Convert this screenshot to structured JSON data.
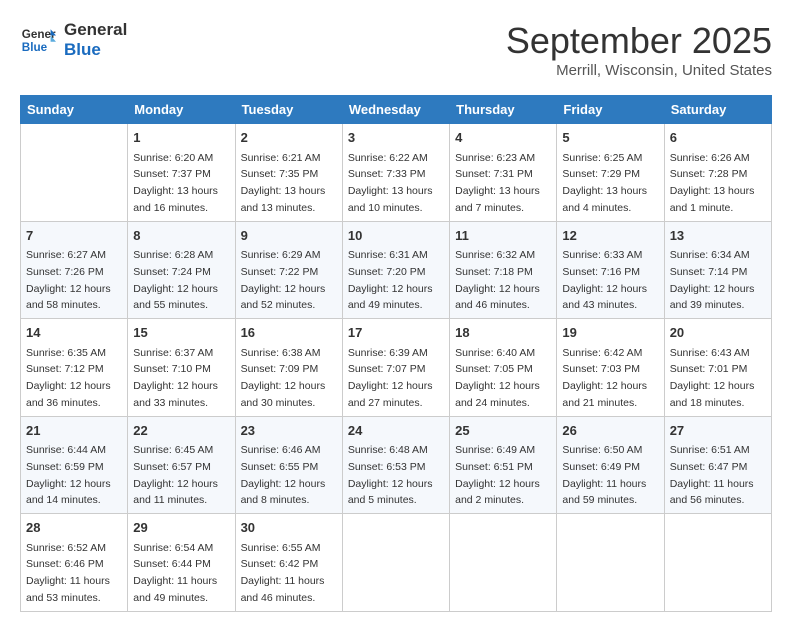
{
  "header": {
    "logo_line1": "General",
    "logo_line2": "Blue",
    "month": "September 2025",
    "location": "Merrill, Wisconsin, United States"
  },
  "weekdays": [
    "Sunday",
    "Monday",
    "Tuesday",
    "Wednesday",
    "Thursday",
    "Friday",
    "Saturday"
  ],
  "weeks": [
    [
      {
        "day": "",
        "sunrise": "",
        "sunset": "",
        "daylight": ""
      },
      {
        "day": "1",
        "sunrise": "Sunrise: 6:20 AM",
        "sunset": "Sunset: 7:37 PM",
        "daylight": "Daylight: 13 hours and 16 minutes."
      },
      {
        "day": "2",
        "sunrise": "Sunrise: 6:21 AM",
        "sunset": "Sunset: 7:35 PM",
        "daylight": "Daylight: 13 hours and 13 minutes."
      },
      {
        "day": "3",
        "sunrise": "Sunrise: 6:22 AM",
        "sunset": "Sunset: 7:33 PM",
        "daylight": "Daylight: 13 hours and 10 minutes."
      },
      {
        "day": "4",
        "sunrise": "Sunrise: 6:23 AM",
        "sunset": "Sunset: 7:31 PM",
        "daylight": "Daylight: 13 hours and 7 minutes."
      },
      {
        "day": "5",
        "sunrise": "Sunrise: 6:25 AM",
        "sunset": "Sunset: 7:29 PM",
        "daylight": "Daylight: 13 hours and 4 minutes."
      },
      {
        "day": "6",
        "sunrise": "Sunrise: 6:26 AM",
        "sunset": "Sunset: 7:28 PM",
        "daylight": "Daylight: 13 hours and 1 minute."
      }
    ],
    [
      {
        "day": "7",
        "sunrise": "Sunrise: 6:27 AM",
        "sunset": "Sunset: 7:26 PM",
        "daylight": "Daylight: 12 hours and 58 minutes."
      },
      {
        "day": "8",
        "sunrise": "Sunrise: 6:28 AM",
        "sunset": "Sunset: 7:24 PM",
        "daylight": "Daylight: 12 hours and 55 minutes."
      },
      {
        "day": "9",
        "sunrise": "Sunrise: 6:29 AM",
        "sunset": "Sunset: 7:22 PM",
        "daylight": "Daylight: 12 hours and 52 minutes."
      },
      {
        "day": "10",
        "sunrise": "Sunrise: 6:31 AM",
        "sunset": "Sunset: 7:20 PM",
        "daylight": "Daylight: 12 hours and 49 minutes."
      },
      {
        "day": "11",
        "sunrise": "Sunrise: 6:32 AM",
        "sunset": "Sunset: 7:18 PM",
        "daylight": "Daylight: 12 hours and 46 minutes."
      },
      {
        "day": "12",
        "sunrise": "Sunrise: 6:33 AM",
        "sunset": "Sunset: 7:16 PM",
        "daylight": "Daylight: 12 hours and 43 minutes."
      },
      {
        "day": "13",
        "sunrise": "Sunrise: 6:34 AM",
        "sunset": "Sunset: 7:14 PM",
        "daylight": "Daylight: 12 hours and 39 minutes."
      }
    ],
    [
      {
        "day": "14",
        "sunrise": "Sunrise: 6:35 AM",
        "sunset": "Sunset: 7:12 PM",
        "daylight": "Daylight: 12 hours and 36 minutes."
      },
      {
        "day": "15",
        "sunrise": "Sunrise: 6:37 AM",
        "sunset": "Sunset: 7:10 PM",
        "daylight": "Daylight: 12 hours and 33 minutes."
      },
      {
        "day": "16",
        "sunrise": "Sunrise: 6:38 AM",
        "sunset": "Sunset: 7:09 PM",
        "daylight": "Daylight: 12 hours and 30 minutes."
      },
      {
        "day": "17",
        "sunrise": "Sunrise: 6:39 AM",
        "sunset": "Sunset: 7:07 PM",
        "daylight": "Daylight: 12 hours and 27 minutes."
      },
      {
        "day": "18",
        "sunrise": "Sunrise: 6:40 AM",
        "sunset": "Sunset: 7:05 PM",
        "daylight": "Daylight: 12 hours and 24 minutes."
      },
      {
        "day": "19",
        "sunrise": "Sunrise: 6:42 AM",
        "sunset": "Sunset: 7:03 PM",
        "daylight": "Daylight: 12 hours and 21 minutes."
      },
      {
        "day": "20",
        "sunrise": "Sunrise: 6:43 AM",
        "sunset": "Sunset: 7:01 PM",
        "daylight": "Daylight: 12 hours and 18 minutes."
      }
    ],
    [
      {
        "day": "21",
        "sunrise": "Sunrise: 6:44 AM",
        "sunset": "Sunset: 6:59 PM",
        "daylight": "Daylight: 12 hours and 14 minutes."
      },
      {
        "day": "22",
        "sunrise": "Sunrise: 6:45 AM",
        "sunset": "Sunset: 6:57 PM",
        "daylight": "Daylight: 12 hours and 11 minutes."
      },
      {
        "day": "23",
        "sunrise": "Sunrise: 6:46 AM",
        "sunset": "Sunset: 6:55 PM",
        "daylight": "Daylight: 12 hours and 8 minutes."
      },
      {
        "day": "24",
        "sunrise": "Sunrise: 6:48 AM",
        "sunset": "Sunset: 6:53 PM",
        "daylight": "Daylight: 12 hours and 5 minutes."
      },
      {
        "day": "25",
        "sunrise": "Sunrise: 6:49 AM",
        "sunset": "Sunset: 6:51 PM",
        "daylight": "Daylight: 12 hours and 2 minutes."
      },
      {
        "day": "26",
        "sunrise": "Sunrise: 6:50 AM",
        "sunset": "Sunset: 6:49 PM",
        "daylight": "Daylight: 11 hours and 59 minutes."
      },
      {
        "day": "27",
        "sunrise": "Sunrise: 6:51 AM",
        "sunset": "Sunset: 6:47 PM",
        "daylight": "Daylight: 11 hours and 56 minutes."
      }
    ],
    [
      {
        "day": "28",
        "sunrise": "Sunrise: 6:52 AM",
        "sunset": "Sunset: 6:46 PM",
        "daylight": "Daylight: 11 hours and 53 minutes."
      },
      {
        "day": "29",
        "sunrise": "Sunrise: 6:54 AM",
        "sunset": "Sunset: 6:44 PM",
        "daylight": "Daylight: 11 hours and 49 minutes."
      },
      {
        "day": "30",
        "sunrise": "Sunrise: 6:55 AM",
        "sunset": "Sunset: 6:42 PM",
        "daylight": "Daylight: 11 hours and 46 minutes."
      },
      {
        "day": "",
        "sunrise": "",
        "sunset": "",
        "daylight": ""
      },
      {
        "day": "",
        "sunrise": "",
        "sunset": "",
        "daylight": ""
      },
      {
        "day": "",
        "sunrise": "",
        "sunset": "",
        "daylight": ""
      },
      {
        "day": "",
        "sunrise": "",
        "sunset": "",
        "daylight": ""
      }
    ]
  ]
}
